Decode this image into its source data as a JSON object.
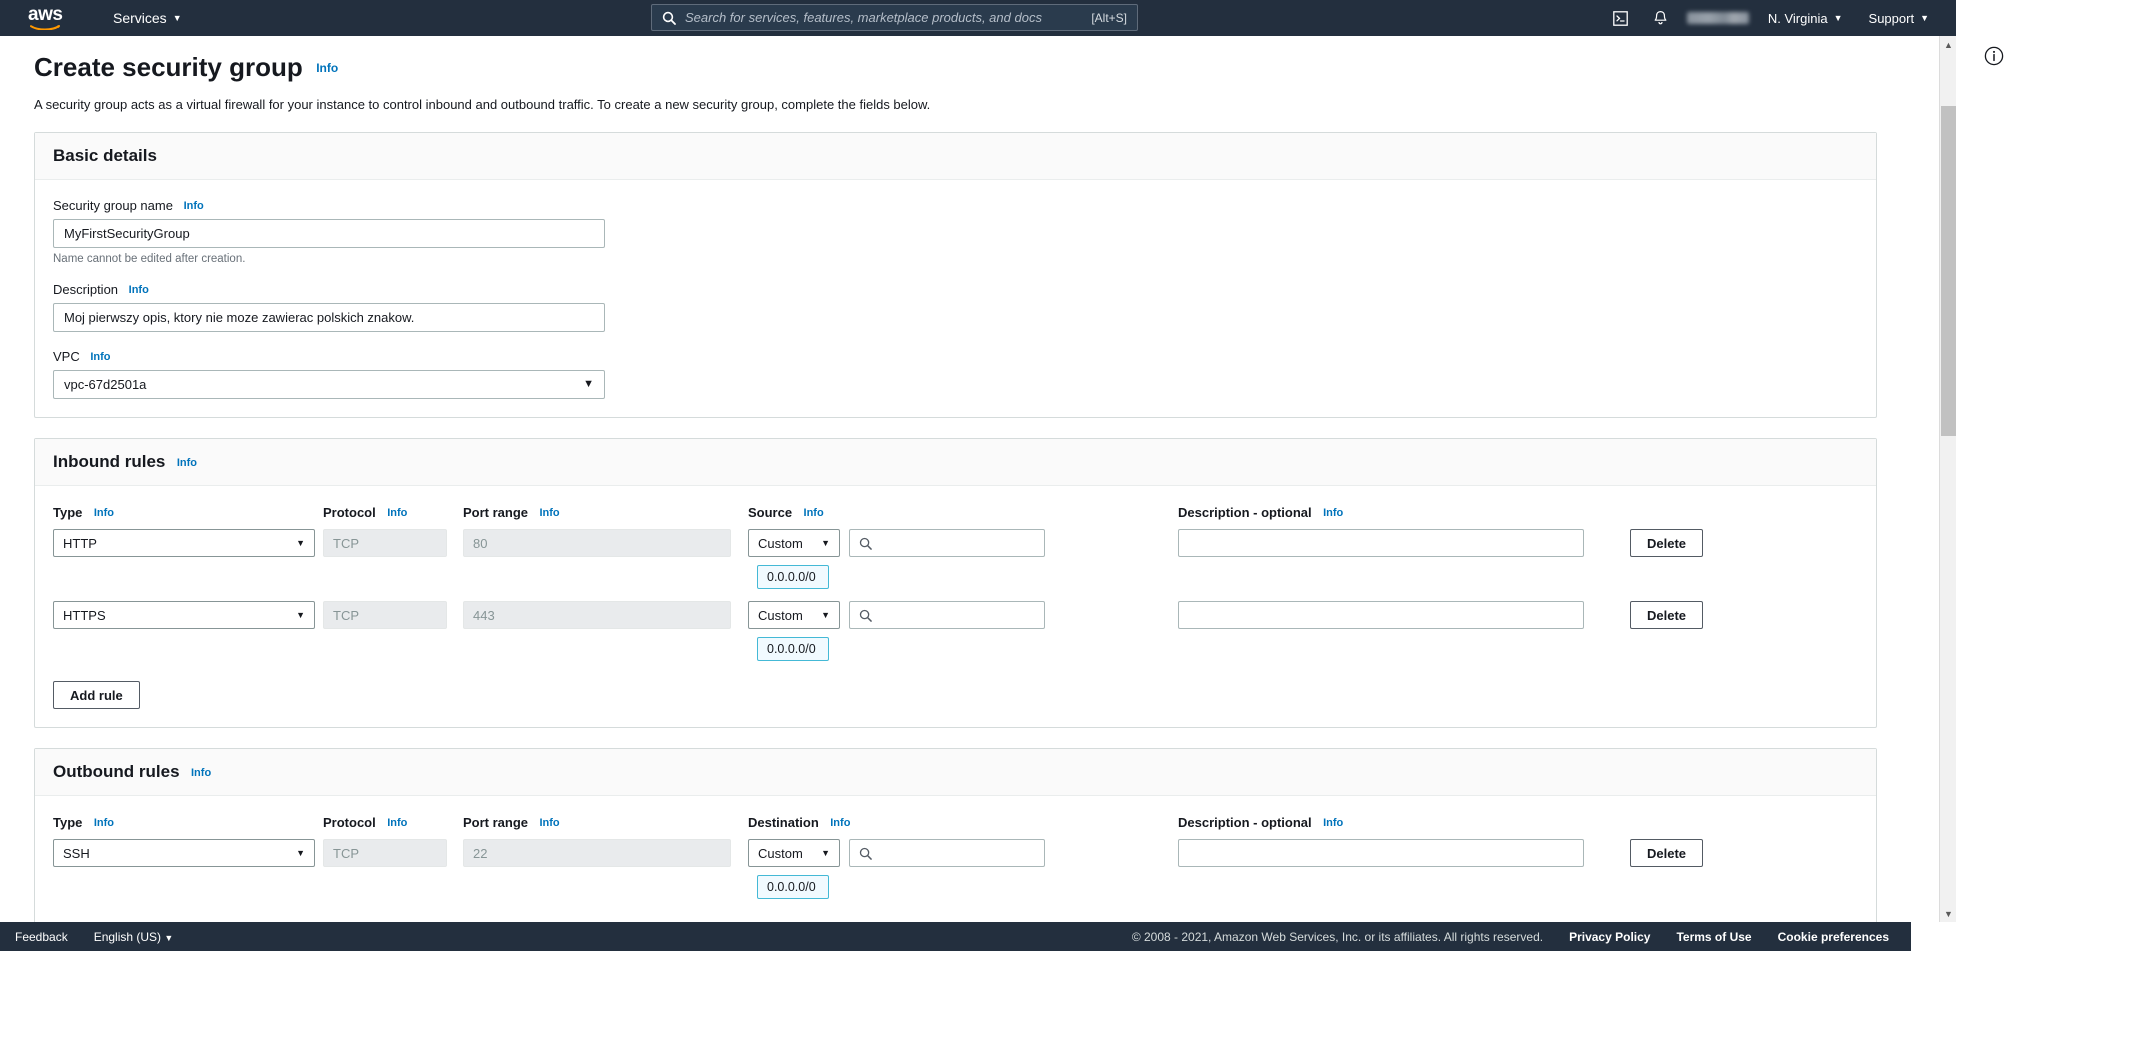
{
  "topnav": {
    "logo_text": "aws",
    "logo_name": "aws-logo",
    "services_label": "Services",
    "search": {
      "placeholder": "Search for services, features, marketplace products, and docs",
      "value": "",
      "shortcut": "[Alt+S]",
      "icon": "search-icon"
    },
    "cloudshell_icon": "cloudshell-icon",
    "bell_icon": "notifications-bell-icon",
    "account_label": "",
    "region_label": "N. Virginia",
    "support_label": "Support"
  },
  "header": {
    "title": "Create security group",
    "info_label": "Info",
    "description": "A security group acts as a virtual firewall for your instance to control inbound and outbound traffic. To create a new security group, complete the fields below."
  },
  "basic_details": {
    "section_title": "Basic details",
    "name_field": {
      "label": "Security group name",
      "info_label": "Info",
      "value": "MyFirstSecurityGroup",
      "placeholder": "",
      "constraint": "Name cannot be edited after creation."
    },
    "description_field": {
      "label": "Description",
      "info_label": "Info",
      "value": "Moj pierwszy opis, ktory nie moze zawierac polskich znakow.",
      "placeholder": ""
    },
    "vpc_field": {
      "label": "VPC",
      "info_label": "Info",
      "value": "vpc-67d2501a",
      "caret": "▼"
    }
  },
  "inbound": {
    "section_title": "Inbound rules",
    "info_label": "Info",
    "columns": {
      "type": "Type",
      "protocol": "Protocol",
      "port_range": "Port range",
      "source": "Source",
      "description": "Description - optional",
      "info_label": "Info"
    },
    "rows": [
      {
        "type": "HTTP",
        "protocol": "TCP",
        "port_range": "80",
        "source_select": "Custom",
        "source_search_value": "",
        "cidr_chip": "0.0.0.0/0",
        "description_value": "",
        "delete_label": "Delete"
      },
      {
        "type": "HTTPS",
        "protocol": "TCP",
        "port_range": "443",
        "source_select": "Custom",
        "source_search_value": "",
        "cidr_chip": "0.0.0.0/0",
        "description_value": "",
        "delete_label": "Delete"
      }
    ],
    "add_rule_label": "Add rule"
  },
  "outbound": {
    "section_title": "Outbound rules",
    "info_label": "Info",
    "columns": {
      "type": "Type",
      "protocol": "Protocol",
      "port_range": "Port range",
      "destination": "Destination",
      "description": "Description - optional",
      "info_label": "Info"
    },
    "rows": [
      {
        "type": "SSH",
        "protocol": "TCP",
        "port_range": "22",
        "destination_select": "Custom",
        "destination_search_value": "",
        "cidr_chip": "0.0.0.0/0",
        "description_value": "",
        "delete_label": "Delete"
      }
    ]
  },
  "right_panel": {
    "info_icon": "info-circle-icon"
  },
  "scrollbar": {
    "up_arrow": "⌃",
    "down_arrow": "⌄"
  },
  "footer": {
    "feedback_label": "Feedback",
    "language_label": "English (US)",
    "copyright": "© 2008 - 2021, Amazon Web Services, Inc. or its affiliates. All rights reserved.",
    "privacy_label": "Privacy Policy",
    "terms_label": "Terms of Use",
    "cookie_label": "Cookie preferences"
  },
  "colors": {
    "nav_bg": "#232f3e",
    "link_blue": "#0073bb",
    "chip_bg": "#f1faff",
    "chip_border": "#44b9d6",
    "readonly_bg": "#e9ebed"
  }
}
